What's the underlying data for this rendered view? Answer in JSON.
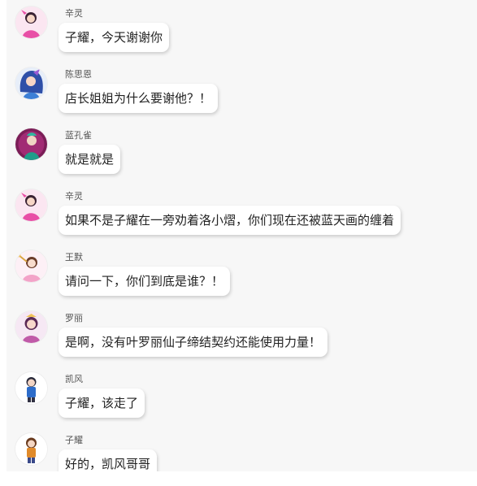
{
  "messages": [
    {
      "name": "辛灵",
      "text": "子耀，今天谢谢你",
      "avatar": "xinling-avatar-icon",
      "avatar_color": "#e84fa6"
    },
    {
      "name": "陈思恩",
      "text": "店长姐姐为什么要谢他？！",
      "avatar": "chensien-avatar-icon",
      "avatar_color": "#3c7fd6"
    },
    {
      "name": "蓝孔雀",
      "text": "就是就是",
      "avatar": "lankongque-avatar-icon",
      "avatar_color": "#8a1f63"
    },
    {
      "name": "辛灵",
      "text": "如果不是子耀在一旁劝着洛小熠，你们现在还被蓝天画的缠着",
      "avatar": "xinling-avatar-icon",
      "avatar_color": "#e84fa6"
    },
    {
      "name": "王默",
      "text": "请问一下，你们到底是谁？！",
      "avatar": "wangmo-avatar-icon",
      "avatar_color": "#f3a3c8"
    },
    {
      "name": "罗丽",
      "text": "是啊，没有叶罗丽仙子缔结契约还能使用力量！",
      "avatar": "luoli-avatar-icon",
      "avatar_color": "#c05aa8"
    },
    {
      "name": "凯风",
      "text": "子耀，该走了",
      "avatar": "kaifeng-avatar-icon",
      "avatar_color": "#2d6cc9"
    },
    {
      "name": "子耀",
      "text": "好的，凯风哥哥",
      "avatar": "ziyao-avatar-icon",
      "avatar_color": "#e08a2a"
    }
  ]
}
